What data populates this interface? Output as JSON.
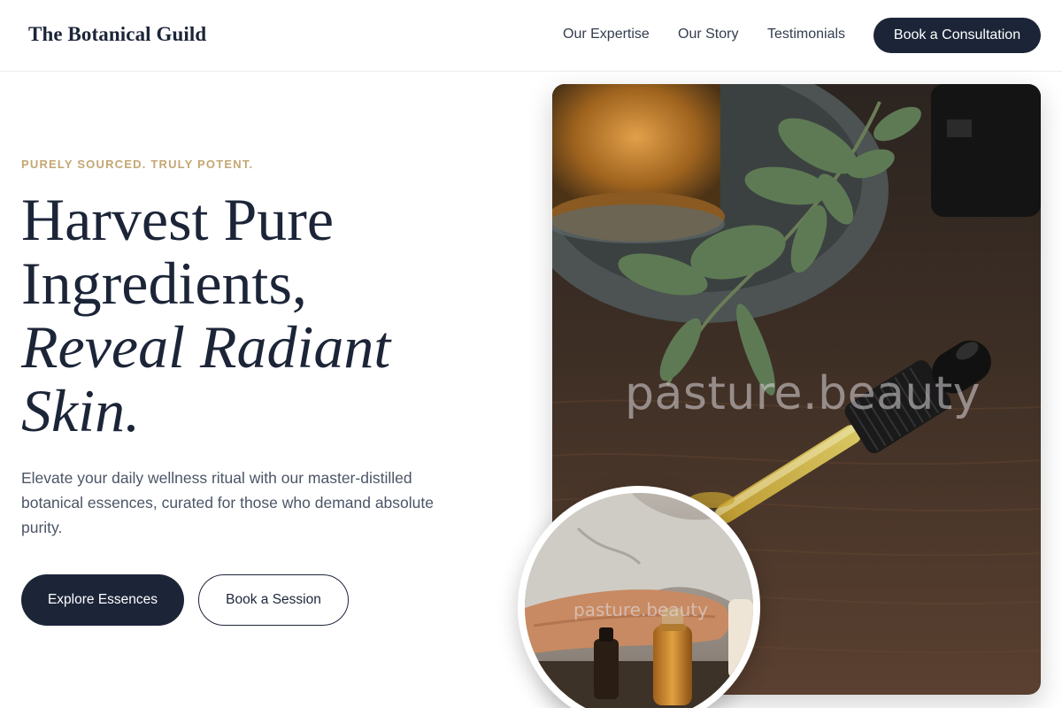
{
  "header": {
    "brand": "The Botanical Guild",
    "nav": {
      "expertise": "Our Expertise",
      "story": "Our Story",
      "testimonials": "Testimonials"
    },
    "cta_label": "Book a Consultation"
  },
  "hero": {
    "eyebrow": "PURELY SOURCED. TRULY POTENT.",
    "headline_line1": "Harvest Pure",
    "headline_line2": "Ingredients,",
    "headline_line3": "Reveal Radiant",
    "headline_line4": "Skin.",
    "subtext": "Elevate your daily wellness ritual with our master-distilled botanical essences, curated for those who demand absolute purity.",
    "primary_button": "Explore Essences",
    "secondary_button": "Book a Session"
  },
  "images": {
    "main_watermark": "pasture.beauty",
    "circle_watermark": "pasture.beauty"
  },
  "colors": {
    "navy": "#1c2538",
    "gold": "#c3a773",
    "body_text": "#4b5566"
  }
}
